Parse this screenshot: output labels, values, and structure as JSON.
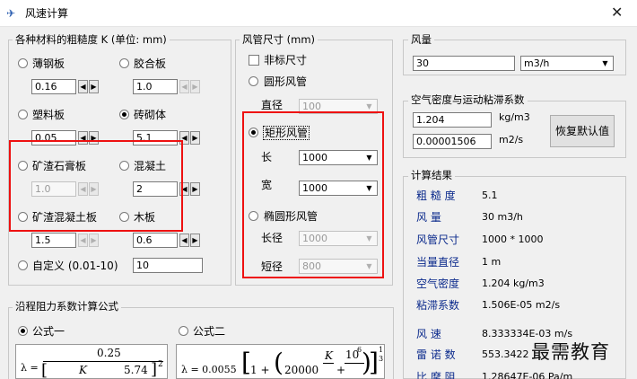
{
  "window": {
    "title": "风速计算",
    "close": "✕"
  },
  "roughness": {
    "group_label": "各种材料的粗糙度 K (单位: mm)",
    "items": [
      {
        "label": "薄钢板",
        "value": "0.16",
        "selected": false
      },
      {
        "label": "胶合板",
        "value": "1.0",
        "selected": false
      },
      {
        "label": "塑料板",
        "value": "0.05",
        "selected": false
      },
      {
        "label": "砖砌体",
        "value": "5.1",
        "selected": true
      },
      {
        "label": "矿渣石膏板",
        "value": "1.0",
        "selected": false
      },
      {
        "label": "混凝土",
        "value": "2",
        "selected": false
      },
      {
        "label": "矿渣混凝土板",
        "value": "1.5",
        "selected": false
      },
      {
        "label": "木板",
        "value": "0.6",
        "selected": false
      }
    ],
    "custom_label": "自定义 (0.01-10)",
    "custom_value": "10"
  },
  "duct": {
    "group_label": "风管尺寸 (mm)",
    "nonstandard_label": "非标尺寸",
    "round_label": "圆形风管",
    "diameter_label": "直径",
    "diameter_value": "100",
    "rect_label": "矩形风管",
    "length_label": "长",
    "length_value": "1000",
    "width_label": "宽",
    "width_value": "1000",
    "ellipse_label": "椭圆形风管",
    "long_label": "长径",
    "long_value": "1000",
    "short_label": "短径",
    "short_value": "800"
  },
  "airflow": {
    "group_label": "风量",
    "value": "30",
    "unit": "m3/h"
  },
  "air": {
    "group_label": "空气密度与运动粘滞系数",
    "density": "1.204",
    "density_unit": "kg/m3",
    "viscosity": "0.00001506",
    "viscosity_unit": "m2/s",
    "reset_button": "恢复默认值"
  },
  "results": {
    "group_label": "计算结果",
    "rows": [
      {
        "k": "粗 糙 度",
        "v": "5.1"
      },
      {
        "k": "风    量",
        "v": "30 m3/h"
      },
      {
        "k": "风管尺寸",
        "v": "1000 * 1000"
      },
      {
        "k": "当量直径",
        "v": "1 m"
      },
      {
        "k": "空气密度",
        "v": "1.204 kg/m3"
      },
      {
        "k": "粘滞系数",
        "v": "1.506E-05 m2/s"
      },
      {
        "k": "风    速",
        "v": "8.333334E-03 m/s"
      },
      {
        "k": "雷 诺 数",
        "v": "553.3422"
      },
      {
        "k": "比 摩 阻",
        "v": "1.28647E-06 Pa/m"
      }
    ]
  },
  "friction": {
    "group_label": "沿程阻力系数计算公式",
    "formula1_label": "公式一",
    "formula2_label": "公式二",
    "f1_lambda": "λ =",
    "f1_num": "0.25",
    "f1_K": "K",
    "f1_const": "5.74",
    "f1_exp": "2",
    "f2_text": "λ = 0.0055",
    "f2_mid": "1 +",
    "f2_coef": "20000",
    "f2_K": "K",
    "f2_plus": "+",
    "f2_ten": "10",
    "f2_six": "6",
    "f2_one": "1",
    "f2_three": "3"
  },
  "watermark": "最需教育"
}
